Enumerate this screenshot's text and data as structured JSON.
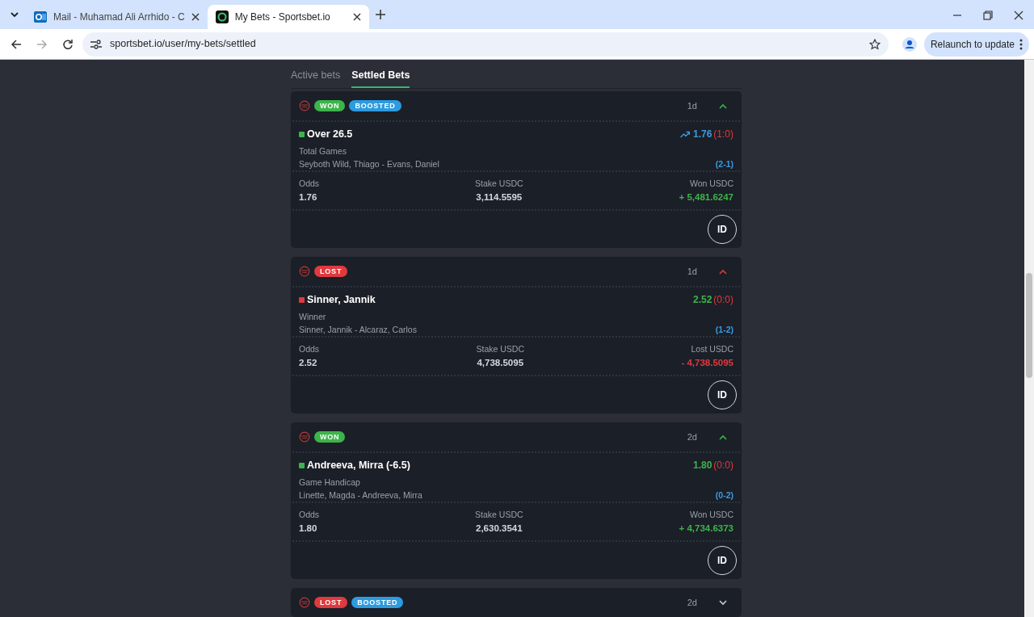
{
  "browser": {
    "tabs": [
      {
        "title": "Mail - Muhamad Ali Arrhido - C",
        "kind": "mail",
        "selected": false
      },
      {
        "title": "My Bets - Sportsbet.io",
        "kind": "site",
        "selected": true
      }
    ],
    "url": "sportsbet.io/user/my-bets/settled",
    "update_button": "Relaunch to update"
  },
  "bet_tabs": [
    {
      "label": "Active bets",
      "selected": false
    },
    {
      "label": "Settled Bets",
      "selected": true
    }
  ],
  "bets": [
    {
      "kind": "won",
      "status_label": "WON",
      "boosted_label": "BOOSTED",
      "age": "1d",
      "expanded": true,
      "selection": "Over 26.5",
      "market": "Total Games",
      "event": "Seyboth Wild, Thiago - Evans, Daniel",
      "odds_trend": true,
      "price": "1.76",
      "score": "(1:0)",
      "sets": "(2-1)",
      "odds_label": "Odds",
      "odds": "1.76",
      "stake_label": "Stake USDC",
      "stake": "3,114.5595",
      "return_label": "Won USDC",
      "return": "+ 5,481.6247",
      "id_button": "ID"
    },
    {
      "kind": "lost",
      "status_label": "LOST",
      "age": "1d",
      "expanded": true,
      "selection": "Sinner, Jannik",
      "market": "Winner",
      "event": "Sinner, Jannik - Alcaraz, Carlos",
      "odds_trend": false,
      "price": "2.52",
      "score": "(0:0)",
      "sets": "(1-2)",
      "odds_label": "Odds",
      "odds": "2.52",
      "stake_label": "Stake USDC",
      "stake": "4,738.5095",
      "return_label": "Lost USDC",
      "return": "- 4,738.5095",
      "id_button": "ID"
    },
    {
      "kind": "won",
      "status_label": "WON",
      "age": "2d",
      "expanded": true,
      "selection": "Andreeva, Mirra (-6.5)",
      "market": "Game Handicap",
      "event": "Linette, Magda - Andreeva, Mirra",
      "odds_trend": false,
      "price": "1.80",
      "score": "(0:0)",
      "sets": "(0-2)",
      "odds_label": "Odds",
      "odds": "1.80",
      "stake_label": "Stake USDC",
      "stake": "2,630.3541",
      "return_label": "Won USDC",
      "return": "+ 4,734.6373",
      "id_button": "ID"
    },
    {
      "kind": "lost",
      "status_label": "LOST",
      "boosted_label": "BOOSTED",
      "age": "2d",
      "expanded": false
    }
  ]
}
